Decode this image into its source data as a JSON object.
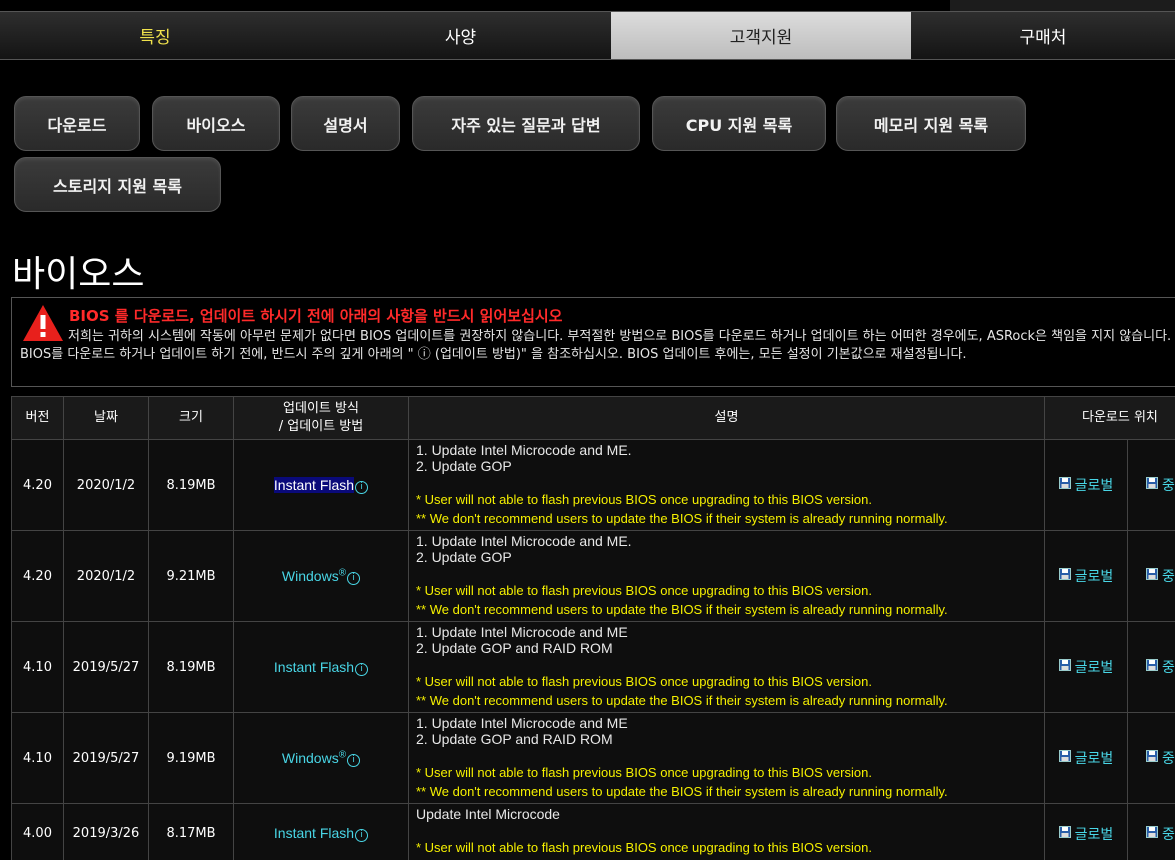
{
  "tabs": [
    "특징",
    "사양",
    "고객지원",
    "구매처"
  ],
  "subnav": [
    "다운로드",
    "바이오스",
    "설명서",
    "자주 있는 질문과 답변",
    "CPU 지원 목록",
    "메모리 지원 목록",
    "스토리지 지원 목록"
  ],
  "page_title": "바이오스",
  "warning": {
    "heading": "BIOS 를 다운로드, 업데이트 하시기 전에 아래의 사항을 반드시 읽어보십시오",
    "body": "저희는 귀하의 시스템에 작동에 아무런 문제가 없다면 BIOS 업데이트를 권장하지 않습니다. 부적절한 방법으로 BIOS를 다운로드 하거나 업데이트 하는 어떠한 경우에도, ASRock은 책임을 지지 않습니다. BIOS를 다운로드 하거나 업데이트 하기 전에, 반드시 주의 깊게 아래의 \" ⓘ (업데이트 방법)\" 을 참조하십시오. BIOS 업데이트 후에는, 모든 설정이 기본값으로 재설정됩니다."
  },
  "table": {
    "headers": {
      "version": "버전",
      "date": "날짜",
      "size": "크기",
      "method_line1": "업데이트 방식",
      "method_line2": "/ 업데이트 방법",
      "desc": "설명",
      "download": "다운로드 위치"
    },
    "rows": [
      {
        "version": "4.20",
        "date": "2020/1/2",
        "size": "8.19MB",
        "method": "Instant Flash",
        "reg": "",
        "lines": [
          "1. Update Intel Microcode and ME.",
          "2. Update GOP"
        ],
        "notes": [
          "* User will not able to flash previous BIOS once upgrading to this BIOS version.",
          "** We don't recommend users to update the BIOS if their system is already running normally."
        ],
        "dl_global": "글로벌",
        "dl_china": "중국"
      },
      {
        "version": "4.20",
        "date": "2020/1/2",
        "size": "9.21MB",
        "method": "Windows",
        "reg": "®",
        "lines": [
          "1. Update Intel Microcode and ME.",
          "2. Update GOP"
        ],
        "notes": [
          "* User will not able to flash previous BIOS once upgrading to this BIOS version.",
          "** We don't recommend users to update the BIOS if their system is already running normally."
        ],
        "dl_global": "글로벌",
        "dl_china": "중국"
      },
      {
        "version": "4.10",
        "date": "2019/5/27",
        "size": "8.19MB",
        "method": "Instant Flash",
        "reg": "",
        "lines": [
          "1. Update Intel Microcode and ME",
          "2. Update GOP and RAID ROM"
        ],
        "notes": [
          "* User will not able to flash previous BIOS once upgrading to this BIOS version.",
          "** We don't recommend users to update the BIOS if their system is already running normally."
        ],
        "dl_global": "글로벌",
        "dl_china": "중국"
      },
      {
        "version": "4.10",
        "date": "2019/5/27",
        "size": "9.19MB",
        "method": "Windows",
        "reg": "®",
        "lines": [
          "1. Update Intel Microcode and ME",
          "2. Update GOP and RAID ROM"
        ],
        "notes": [
          "* User will not able to flash previous BIOS once upgrading to this BIOS version.",
          "** We don't recommend users to update the BIOS if their system is already running normally."
        ],
        "dl_global": "글로벌",
        "dl_china": "중국"
      },
      {
        "version": "4.00",
        "date": "2019/3/26",
        "size": "8.17MB",
        "method": "Instant Flash",
        "reg": "",
        "lines": [
          "Update Intel Microcode"
        ],
        "notes": [
          "* User will not able to flash previous BIOS once upgrading to this BIOS version."
        ],
        "dl_global": "글로벌",
        "dl_china": "중국"
      }
    ]
  },
  "colors": {
    "accent_tab": "#f0e24c",
    "link": "#49d6e6",
    "warning": "#ff2a2a",
    "note": "#f5f000"
  },
  "icons": {
    "warning": "warning-triangle-icon",
    "info": "info-circle-icon",
    "download": "floppy-disk-icon"
  }
}
